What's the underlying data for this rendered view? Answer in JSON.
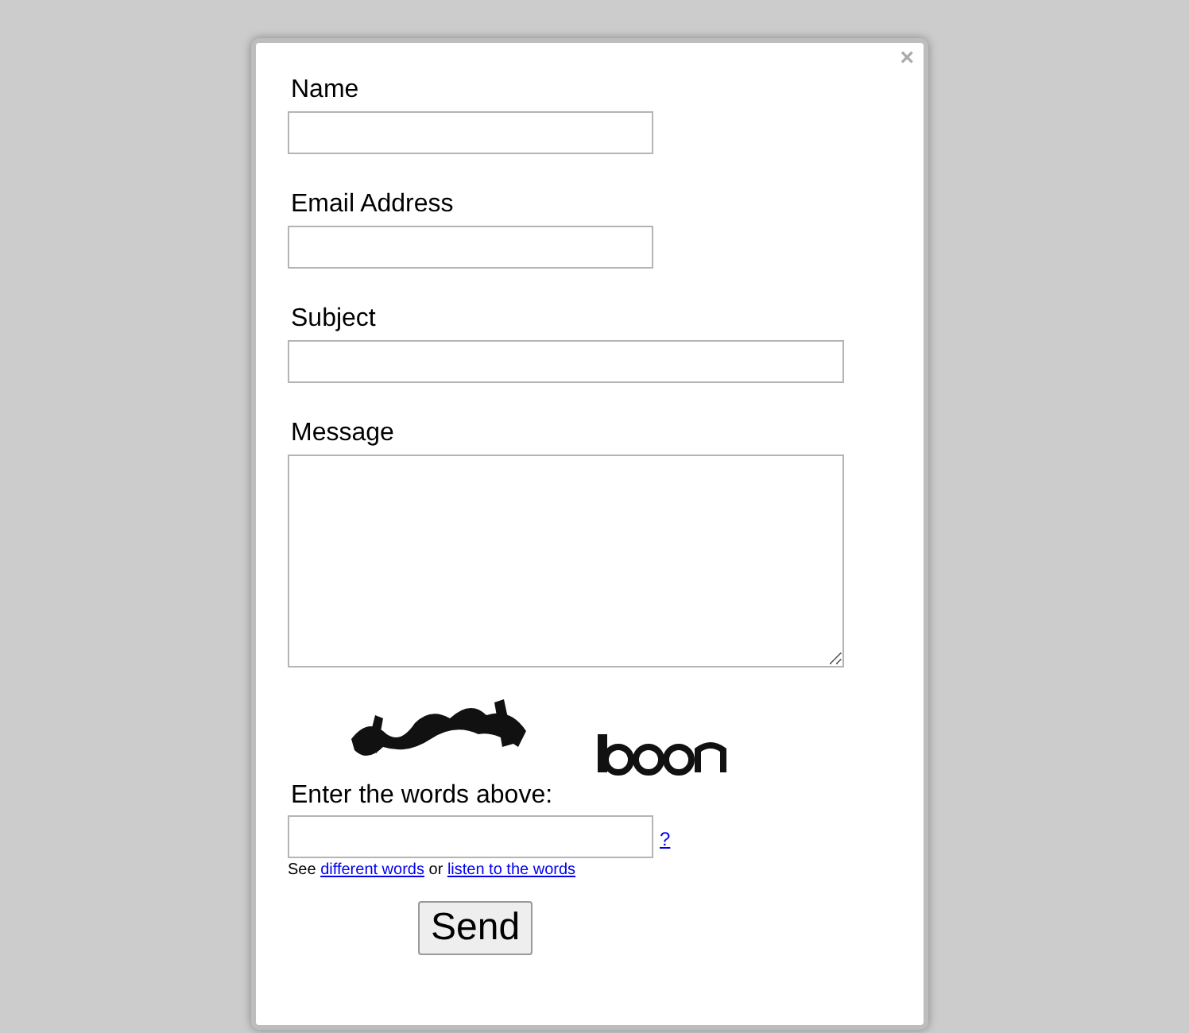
{
  "close": "×",
  "fields": [
    {
      "label": "Name",
      "kind": "short"
    },
    {
      "label": "Email Address",
      "kind": "short"
    },
    {
      "label": "Subject",
      "kind": "wide"
    },
    {
      "label": "Message",
      "kind": "textarea"
    }
  ],
  "captcha": {
    "kind": "picture",
    "prompt": "Enter the words above:",
    "help_link": "?",
    "hint": {
      "before": "See",
      "link_1": "different words",
      "middle": "or",
      "link_2": "listen to the words"
    }
  },
  "submit": "Send"
}
